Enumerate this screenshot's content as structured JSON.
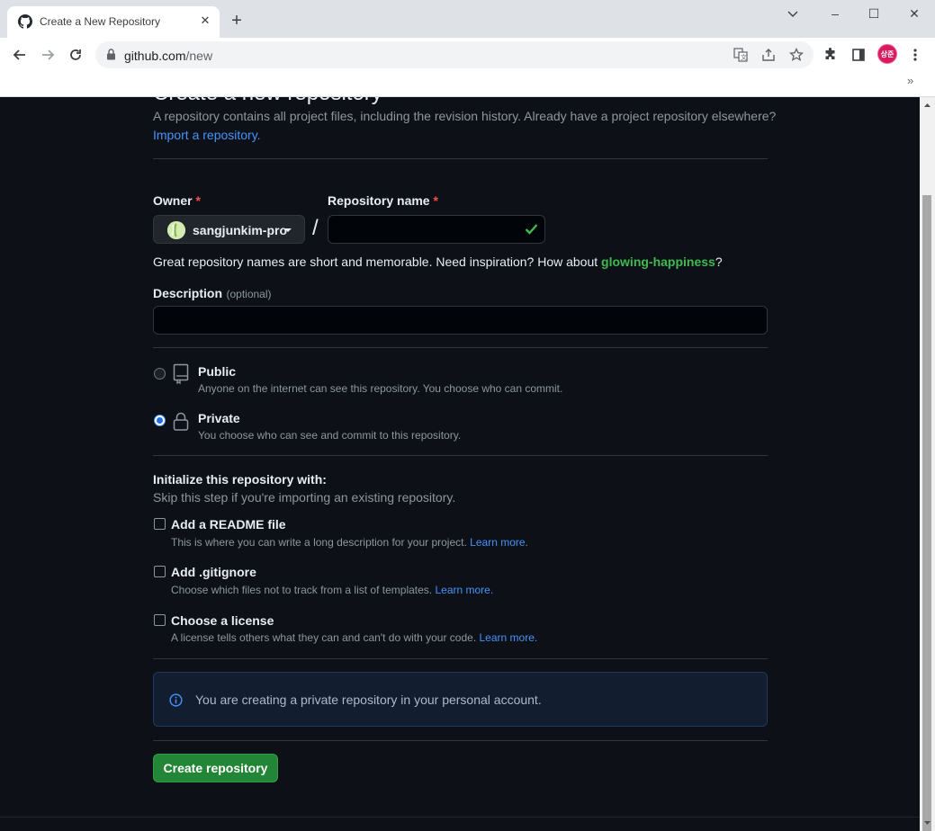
{
  "browser": {
    "tab_title": "Create a New Repository",
    "url_host": "github.com",
    "url_path": "/new",
    "profile_initials": "상준",
    "minimize_glyph": "–",
    "maximize_glyph": "☐",
    "close_glyph": "✕",
    "newtab_glyph": "+",
    "tabclose_glyph": "✕",
    "bookmarks_more": "»"
  },
  "page": {
    "heading": "Create a new repository",
    "intro": "A repository contains all project files, including the revision history. Already have a project repository elsewhere?",
    "import_link": "Import a repository.",
    "owner_label": "Owner",
    "required_mark": "*",
    "owner_value": "sangjunkim-pro",
    "separator": "/",
    "repo_name_label": "Repository name",
    "repo_name_value": "",
    "name_hint_prefix": "Great repository names are short and memorable. Need inspiration? How about ",
    "name_suggestion": "glowing-happiness",
    "name_hint_suffix": "?",
    "description_label": "Description",
    "description_optional": "(optional)",
    "description_value": "",
    "visibility": [
      {
        "label": "Public",
        "desc": "Anyone on the internet can see this repository. You choose who can commit.",
        "checked": false
      },
      {
        "label": "Private",
        "desc": "You choose who can see and commit to this repository.",
        "checked": true
      }
    ],
    "init_title": "Initialize this repository with:",
    "init_subtitle": "Skip this step if you're importing an existing repository.",
    "init_options": [
      {
        "label": "Add a README file",
        "desc": "This is where you can write a long description for your project.",
        "link": "Learn more.",
        "checked": false
      },
      {
        "label": "Add .gitignore",
        "desc": "Choose which files not to track from a list of templates.",
        "link": "Learn more.",
        "checked": false
      },
      {
        "label": "Choose a license",
        "desc": "A license tells others what they can and can't do with your code.",
        "link": "Learn more.",
        "checked": false
      }
    ],
    "flash_message": "You are creating a private repository in your personal account.",
    "create_button": "Create repository"
  },
  "colors": {
    "page_bg": "#0d1117",
    "accent_green": "#238636",
    "link_blue": "#4493f8",
    "suggestion_green": "#3fb950",
    "required_red": "#f85149"
  }
}
